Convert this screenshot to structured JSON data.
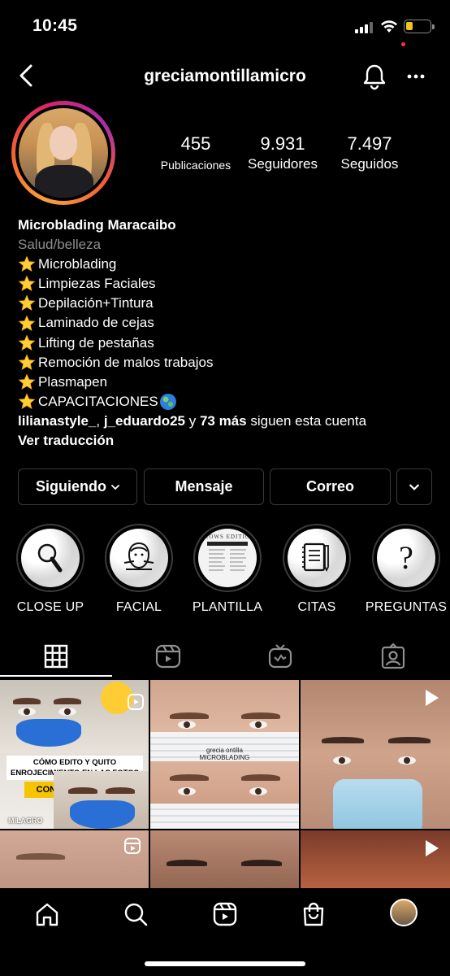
{
  "status_bar": {
    "time": "10:45",
    "battery_level": 0.3
  },
  "header": {
    "username": "greciamontillamicro"
  },
  "stats": {
    "posts": {
      "value": "455",
      "label": "Publicaciones"
    },
    "followers": {
      "value": "9.931",
      "label": "Seguidores"
    },
    "following": {
      "value": "7.497",
      "label": "Seguidos"
    }
  },
  "bio": {
    "name": "Microblading Maracaibo",
    "category": "Salud/belleza",
    "lines": [
      "Microblading",
      "Limpiezas Faciales",
      "Depilación+Tintura",
      "Laminado de cejas",
      "Lifting de pestañas",
      "Remoción de malos trabajos",
      "Plasmapen",
      "CAPACITACIONES"
    ],
    "followed_by": {
      "user1": "lilianastyle_",
      "sep": ", ",
      "user2": "j_eduardo25",
      "and": " y ",
      "more": "73 más",
      "suffix": " siguen esta cuenta"
    },
    "translate": "Ver traducción"
  },
  "buttons": {
    "following": "Siguiendo",
    "message": "Mensaje",
    "email": "Correo"
  },
  "highlights": [
    {
      "label": "CLOSE UP",
      "icon": "magnifier-icon"
    },
    {
      "label": "FACIAL",
      "icon": "face-mask-icon"
    },
    {
      "label": "PLANTILLA",
      "icon": "template-sheet-icon",
      "cover_text": "BROWS EDITION"
    },
    {
      "label": "CITAS",
      "icon": "notebook-pencil-icon"
    },
    {
      "label": "PREGUNTAS",
      "icon": "question-mark-icon"
    }
  ],
  "tabs": [
    "grid-icon",
    "reels-icon",
    "igtv-icon",
    "tagged-icon"
  ],
  "posts": {
    "p1": {
      "caption": "CÓMO EDITO Y QUITO ENROJECIMIENTO EN LAS FOTOS",
      "banner": "CON LIGHTROOM",
      "tag": "MILAGRO"
    },
    "p2": {
      "watermark": "grecia  ontilla",
      "watermark2": "MICROBLADING"
    }
  },
  "colors": {
    "background": "#000000",
    "story_ring": "#d6246e",
    "notification_dot": "#ff3040",
    "battery": "#f5c518"
  }
}
